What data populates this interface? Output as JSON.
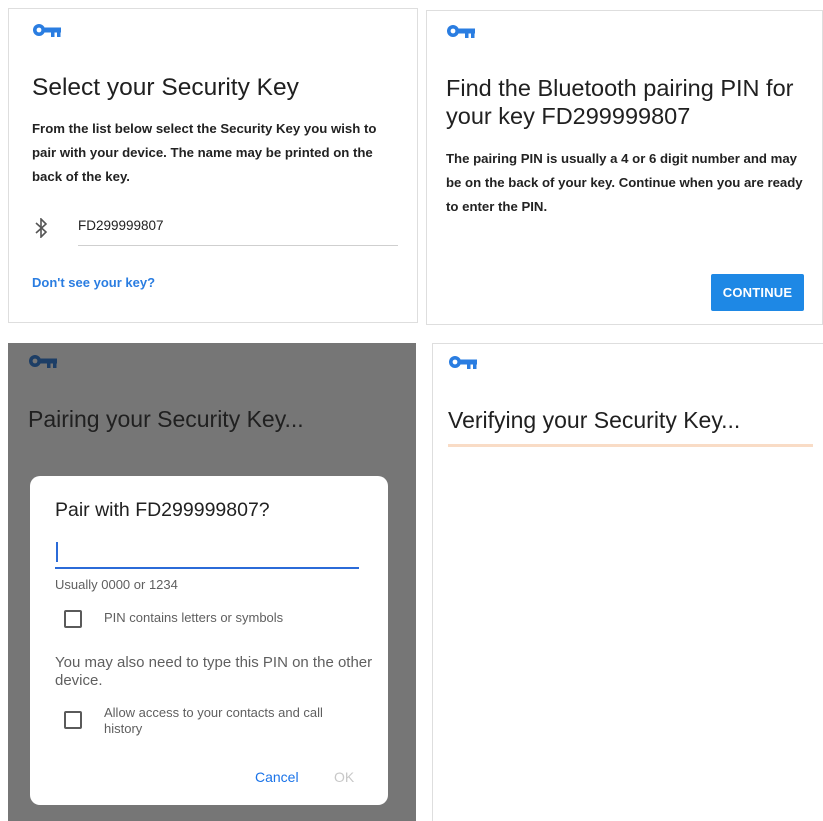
{
  "select_panel": {
    "title": "Select your Security Key",
    "description": "From the list below select the Security Key you wish to pair with your device. The name may be printed on the back of the key.",
    "device_name": "FD299999807",
    "link_label": "Don't see your key?"
  },
  "pin_panel": {
    "title": "Find the Bluetooth pairing PIN for your key FD299999807",
    "description": "The pairing PIN is usually a 4 or 6 digit number and may be on the back of your key. Continue when you are ready to enter the PIN.",
    "continue_label": "CONTINUE"
  },
  "pairing_panel": {
    "title": "Pairing your Security Key...",
    "dialog": {
      "title": "Pair with FD299999807?",
      "pin_value": "",
      "pin_hint": "Usually 0000 or 1234",
      "checkbox_letters_label": "PIN contains letters or symbols",
      "checkbox_letters_checked": false,
      "note": "You may also need to type this PIN on the other device.",
      "checkbox_contacts_label": "Allow access to your contacts and call history",
      "checkbox_contacts_checked": false,
      "cancel_label": "Cancel",
      "ok_label": "OK"
    }
  },
  "verify_panel": {
    "title": "Verifying your Security Key...",
    "progress": 0
  },
  "colors": {
    "key_icon": "#2a7de1",
    "key_icon_dimmed": "#1d3e66",
    "accent": "#1e88e5",
    "progress_track": "#f9dcc6"
  },
  "icons": [
    "key-icon",
    "bluetooth-icon"
  ]
}
